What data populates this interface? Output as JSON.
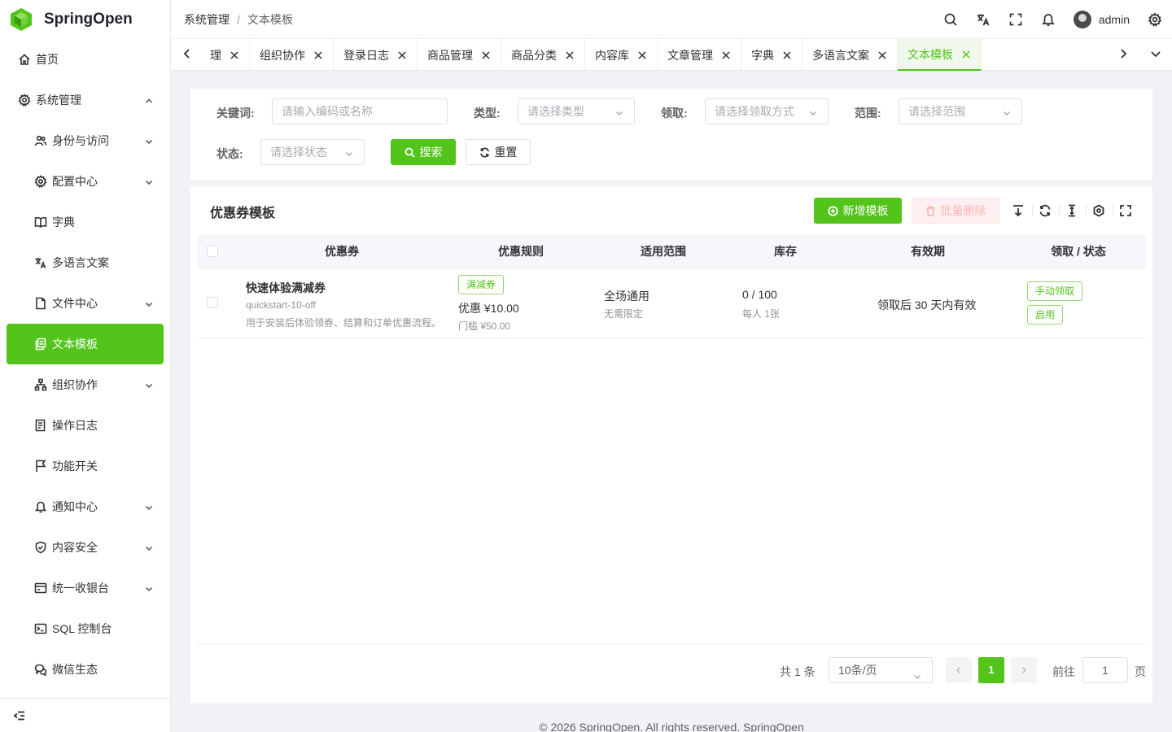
{
  "app": {
    "name": "SpringOpen"
  },
  "sidebar": {
    "items": [
      {
        "label": "首页",
        "icon": "home-icon"
      },
      {
        "label": "系统管理",
        "icon": "gear-icon"
      },
      {
        "label": "身份与访问",
        "icon": "users-icon"
      },
      {
        "label": "配置中心",
        "icon": "settings-icon"
      },
      {
        "label": "字典",
        "icon": "book-icon"
      },
      {
        "label": "多语言文案",
        "icon": "translate-icon"
      },
      {
        "label": "文件中心",
        "icon": "file-icon"
      },
      {
        "label": "文本模板",
        "icon": "copy-icon"
      },
      {
        "label": "组织协作",
        "icon": "org-icon"
      },
      {
        "label": "操作日志",
        "icon": "log-icon"
      },
      {
        "label": "功能开关",
        "icon": "flag-icon"
      },
      {
        "label": "通知中心",
        "icon": "bell-icon"
      },
      {
        "label": "内容安全",
        "icon": "shield-icon"
      },
      {
        "label": "统一收银台",
        "icon": "cashier-icon"
      },
      {
        "label": "SQL 控制台",
        "icon": "terminal-icon"
      },
      {
        "label": "微信生态",
        "icon": "chat-icon"
      }
    ]
  },
  "header": {
    "breadcrumb": [
      "系统管理",
      "文本模板"
    ],
    "breadcrumb_sep": "/",
    "username": "admin"
  },
  "tabs": [
    {
      "label": "理"
    },
    {
      "label": "组织协作"
    },
    {
      "label": "登录日志"
    },
    {
      "label": "商品管理"
    },
    {
      "label": "商品分类"
    },
    {
      "label": "内容库"
    },
    {
      "label": "文章管理"
    },
    {
      "label": "字典"
    },
    {
      "label": "多语言文案"
    },
    {
      "label": "文本模板"
    }
  ],
  "search": {
    "keyword_label": "关键词:",
    "keyword_placeholder": "请输入编码或名称",
    "type_label": "类型:",
    "type_placeholder": "请选择类型",
    "claim_label": "领取:",
    "claim_placeholder": "请选择领取方式",
    "scope_label": "范围:",
    "scope_placeholder": "请选择范围",
    "status_label": "状态:",
    "status_placeholder": "请选择状态",
    "search_button": "搜索",
    "reset_button": "重置"
  },
  "table": {
    "title": "优惠券模板",
    "add_button": "新增模板",
    "batch_delete_button": "批量删除",
    "columns": [
      "优惠券",
      "优惠规则",
      "适用范围",
      "库存",
      "有效期",
      "领取 / 状态"
    ],
    "rows": [
      {
        "title": "快速体验满减券",
        "code": "quickstart-10-off",
        "desc": "用于安装后体验领券、结算和订单优惠流程。",
        "rule_tag": "满减券",
        "rule_main": "优惠 ¥10.00",
        "rule_sub": "门槛 ¥50.00",
        "scope_main": "全场通用",
        "scope_sub": "无需限定",
        "stock_main": "0 / 100",
        "stock_sub": "每人 1张",
        "validity": "领取后 30 天内有效",
        "claim_tag": "手动领取",
        "status_tag": "启用"
      }
    ]
  },
  "pagination": {
    "total": "共 1 条",
    "page_size": "10条/页",
    "current_page": "1",
    "goto_label": "前往",
    "goto_value": "1",
    "page_suffix": "页"
  },
  "footer": {
    "text": "© 2026 SpringOpen. All rights reserved. SpringOpen"
  },
  "colors": {
    "accent": "#52c41a",
    "danger_light": "#fef0f0"
  }
}
